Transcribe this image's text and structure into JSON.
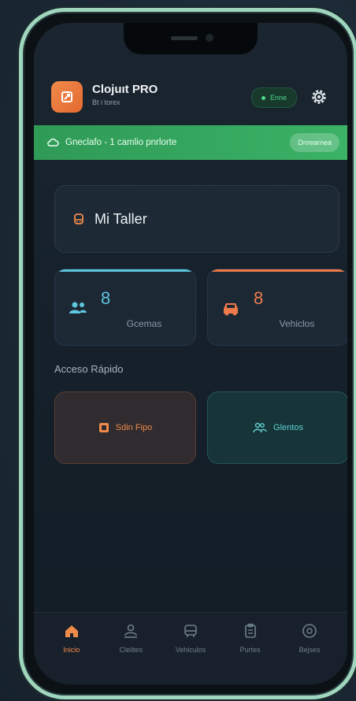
{
  "header": {
    "title": "Clojuıt PRO",
    "subtitle": "Bt i torex",
    "status_label": "Enne",
    "settings_icon": "gear-icon"
  },
  "sync_bar": {
    "text": "Gneclafo - 1 camlio pnrlorte",
    "button_label": "Dnrearnea"
  },
  "workshop": {
    "label": "Mi Taller"
  },
  "stats": [
    {
      "value": "8",
      "label": "Gcemas",
      "color": "#5fc6e0"
    },
    {
      "value": "8",
      "label": "Vehiclos",
      "color": "#f07a4a"
    }
  ],
  "quick_access": {
    "title": "Acceso Rápido",
    "items": [
      {
        "label": "Sdin Fipo",
        "color": "#f08a4b"
      },
      {
        "label": "Glentos",
        "color": "#5fd0d2"
      }
    ]
  },
  "tabs": [
    {
      "label": "Inicio",
      "icon": "home-icon",
      "active": true
    },
    {
      "label": "Cleiltes",
      "icon": "clients-icon",
      "active": false
    },
    {
      "label": "Vehiculos",
      "icon": "car-icon",
      "active": false
    },
    {
      "label": "Purtes",
      "icon": "clipboard-icon",
      "active": false
    },
    {
      "label": "Bejses",
      "icon": "clock-icon",
      "active": false
    }
  ],
  "colors": {
    "accent_orange": "#f08a4b",
    "accent_teal": "#5fc6e0",
    "sync_green": "#3bb266",
    "status_green": "#4fd68b"
  }
}
